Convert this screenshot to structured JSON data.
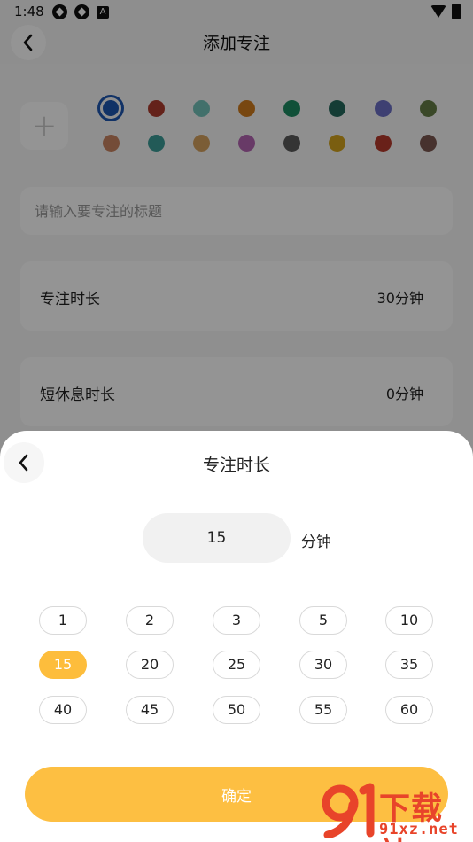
{
  "status_bar": {
    "time": "1:48",
    "notif_a": "A"
  },
  "header": {
    "title": "添加专注"
  },
  "colors": {
    "row1": [
      "#1e56b0",
      "#ad3c2e",
      "#72c2b8",
      "#cf7a1d",
      "#1d8a61",
      "#23685c",
      "#6b6ec4",
      "#647d45"
    ],
    "row2": [
      "#c88461",
      "#3b9b97",
      "#d4a15e",
      "#b465b1",
      "#5a5a5a",
      "#d2a21c",
      "#b53a2c",
      "#7a5750"
    ]
  },
  "form": {
    "title_placeholder": "请输入要专注的标题",
    "focus_label": "专注时长",
    "focus_value": "30分钟",
    "break_label": "短休息时长",
    "break_value": "0分钟"
  },
  "sheet": {
    "title": "专注时长",
    "minutes_value": "15",
    "unit": "分钟",
    "options": [
      "1",
      "2",
      "3",
      "5",
      "10",
      "15",
      "20",
      "25",
      "30",
      "35",
      "40",
      "45",
      "50",
      "55",
      "60"
    ],
    "selected": "15",
    "confirm_label": "确定"
  },
  "watermark": {
    "brand": "下载站",
    "url": "91xz.net"
  }
}
